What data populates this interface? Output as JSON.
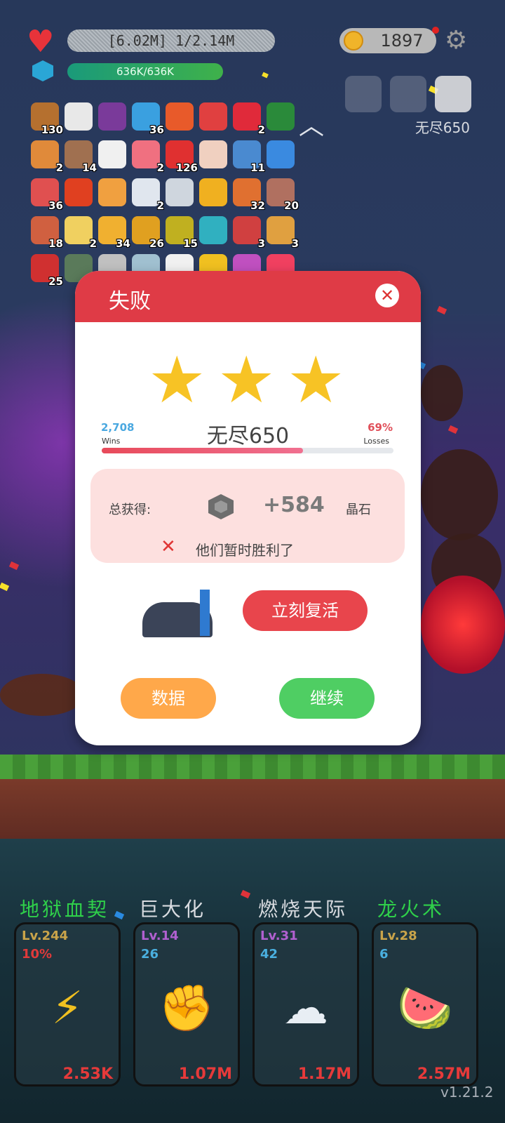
{
  "hud": {
    "hp_text": "[6.02M] 1/2.14M",
    "shield_text": "636K/636K",
    "coins": "1897",
    "endless_label": "无尽650"
  },
  "inventory": [
    {
      "name": "book",
      "count": "130",
      "color": "#b5702f"
    },
    {
      "name": "chat-bubble",
      "count": "",
      "color": "#e8e8e8"
    },
    {
      "name": "witch-hat",
      "count": "",
      "color": "#7a3a9a"
    },
    {
      "name": "speech-blue",
      "count": "36",
      "color": "#3aa0e0"
    },
    {
      "name": "flame-ring",
      "count": "",
      "color": "#e85a2a"
    },
    {
      "name": "red-shield",
      "count": "",
      "color": "#e04040"
    },
    {
      "name": "strawberry",
      "count": "2",
      "color": "#e02a3a"
    },
    {
      "name": "green-hat",
      "count": "",
      "color": "#2a8a3a"
    },
    {
      "name": "briefcase",
      "count": "2",
      "color": "#e08a3a"
    },
    {
      "name": "meteor",
      "count": "14",
      "color": "#a07050"
    },
    {
      "name": "checklist",
      "count": "",
      "color": "#f0f0f0"
    },
    {
      "name": "calendar",
      "count": "2",
      "color": "#f07080"
    },
    {
      "name": "apple",
      "count": "126",
      "color": "#e03030"
    },
    {
      "name": "thermometer",
      "count": "",
      "color": "#f0d0c0"
    },
    {
      "name": "shirt",
      "count": "11",
      "color": "#4a8ad0"
    },
    {
      "name": "id-card",
      "count": "",
      "color": "#3a8ae0"
    },
    {
      "name": "potion",
      "count": "36",
      "color": "#e05050"
    },
    {
      "name": "heat-waves",
      "count": "",
      "color": "#e04020"
    },
    {
      "name": "menu-board",
      "count": "",
      "color": "#f0a040"
    },
    {
      "name": "envelope",
      "count": "2",
      "color": "#e0e6ee"
    },
    {
      "name": "molecule",
      "count": "",
      "color": "#cfd6de"
    },
    {
      "name": "orb",
      "count": "",
      "color": "#f0b020"
    },
    {
      "name": "target",
      "count": "32",
      "color": "#e07030"
    },
    {
      "name": "door",
      "count": "20",
      "color": "#b07060"
    },
    {
      "name": "flag",
      "count": "18",
      "color": "#d06040"
    },
    {
      "name": "notebook",
      "count": "2",
      "color": "#f0d060"
    },
    {
      "name": "beer",
      "count": "34",
      "color": "#f0b030"
    },
    {
      "name": "pineapple",
      "count": "26",
      "color": "#e0a020"
    },
    {
      "name": "durian",
      "count": "15",
      "color": "#c0b020"
    },
    {
      "name": "spiral",
      "count": "",
      "color": "#30b0c0"
    },
    {
      "name": "badge",
      "count": "3",
      "color": "#d04040"
    },
    {
      "name": "scroll",
      "count": "3",
      "color": "#e0a040"
    },
    {
      "name": "red-flag",
      "count": "25",
      "color": "#d03030"
    },
    {
      "name": "zombie",
      "count": "",
      "color": "#5a7a5a"
    },
    {
      "name": "mushroom",
      "count": "",
      "color": "#c0c0c0"
    },
    {
      "name": "ghost",
      "count": "",
      "color": "#a0c0d0"
    },
    {
      "name": "egg",
      "count": "",
      "color": "#f0f0f0"
    },
    {
      "name": "sunflower",
      "count": "",
      "color": "#f0c020"
    },
    {
      "name": "flower",
      "count": "",
      "color": "#c050c0"
    },
    {
      "name": "fire",
      "count": "",
      "color": "#f04060"
    }
  ],
  "dialog": {
    "title": "失败",
    "close": "✕",
    "wins_value": "2,708",
    "wins_label": "Wins",
    "losses_value": "69%",
    "losses_label": "Losses",
    "stage": "无尽650",
    "progress": 0.69,
    "reward_label": "总获得:",
    "reward_amount": "+584",
    "reward_unit": "晶石",
    "defeat_icon": "✕",
    "defeat_message": "他们暂时胜利了",
    "revive_label": "立刻复活",
    "stats_label": "数据",
    "continue_label": "继续"
  },
  "skills": [
    {
      "title": "地狱血契",
      "title_color": "#2fd04a",
      "lv": "Lv.244",
      "sub": "10%",
      "sub_color": "#e03a3a",
      "icon": "⚡",
      "icon_name": "lightning-icon",
      "value": "2.53K"
    },
    {
      "title": "巨大化",
      "title_color": "#d8dbe0",
      "lv": "Lv.14",
      "sub": "26",
      "sub_color": "#4ab0e0",
      "icon": "✊",
      "icon_name": "fist-icon",
      "value": "1.07M"
    },
    {
      "title": "燃烧天际",
      "title_color": "#d8dbe0",
      "lv": "Lv.31",
      "sub": "42",
      "sub_color": "#4ab0e0",
      "icon": "☁",
      "icon_name": "fire-cloud-icon",
      "value": "1.17M"
    },
    {
      "title": "龙火术",
      "title_color": "#2fd04a",
      "lv": "Lv.28",
      "sub": "6",
      "sub_color": "#4ab0e0",
      "icon": "🍉",
      "icon_name": "watermelon-icon",
      "value": "2.57M"
    }
  ],
  "version": "v1.21.2"
}
